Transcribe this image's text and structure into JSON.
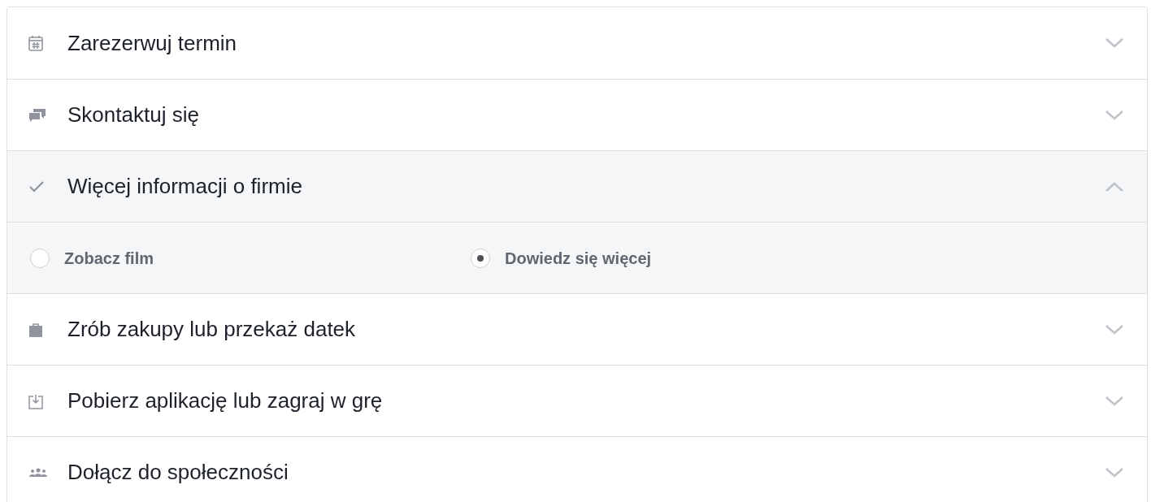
{
  "items": [
    {
      "kind": "calendar",
      "label": "Zarezerwuj termin",
      "expanded": false
    },
    {
      "kind": "chat",
      "label": "Skontaktuj się",
      "expanded": false
    },
    {
      "kind": "check",
      "label": "Więcej informacji o firmie",
      "expanded": true,
      "options": [
        {
          "label": "Zobacz film",
          "selected": false
        },
        {
          "label": "Dowiedz się więcej",
          "selected": true
        }
      ]
    },
    {
      "kind": "bag",
      "label": "Zrób zakupy lub przekaż datek",
      "expanded": false
    },
    {
      "kind": "download",
      "label": "Pobierz aplikację lub zagraj w grę",
      "expanded": false
    },
    {
      "kind": "people",
      "label": "Dołącz do społeczności",
      "expanded": false
    }
  ]
}
